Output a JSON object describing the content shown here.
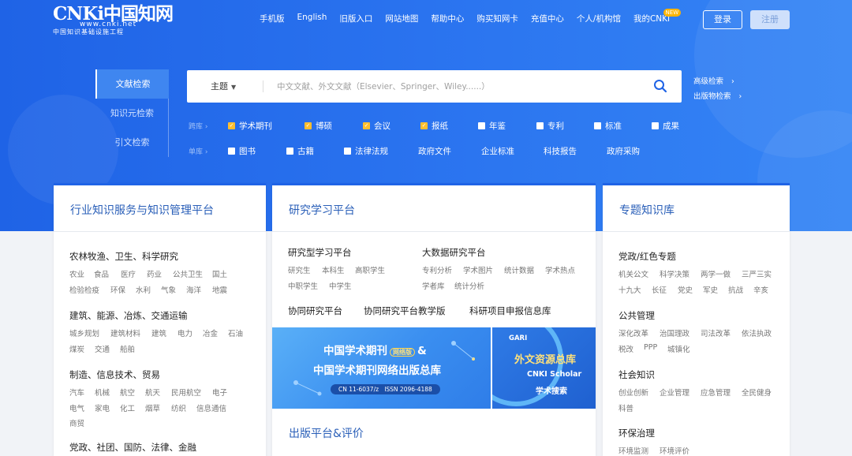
{
  "header": {
    "logo_main": "CNKi中国知网",
    "logo_url": "www.cnki.net",
    "logo_sub": "中国知识基础设施工程",
    "nav": [
      "手机版",
      "English",
      "旧版入口",
      "网站地图",
      "帮助中心",
      "购买知网卡",
      "充值中心",
      "个人/机构馆",
      "我的CNKI"
    ],
    "new_badge": "NEW",
    "login": "登录",
    "register": "注册"
  },
  "search": {
    "tabs": [
      "文献检索",
      "知识元检索",
      "引文检索"
    ],
    "type": "主题",
    "placeholder": "中文文献、外文文献（Elsevier、Springer、Wiley......）",
    "advanced": "高级检索",
    "publication": "出版物检索",
    "row1_label": "跨库",
    "row2_label": "单库",
    "row1": [
      {
        "label": "学术期刊",
        "checked": true
      },
      {
        "label": "博硕",
        "checked": true
      },
      {
        "label": "会议",
        "checked": true
      },
      {
        "label": "报纸",
        "checked": true
      },
      {
        "label": "年鉴",
        "checked": false
      },
      {
        "label": "专利",
        "checked": false
      },
      {
        "label": "标准",
        "checked": false
      },
      {
        "label": "成果",
        "checked": false
      }
    ],
    "row2": [
      {
        "label": "图书",
        "checkbox": true
      },
      {
        "label": "古籍",
        "checkbox": true
      },
      {
        "label": "法律法规",
        "checkbox": true
      },
      {
        "label": "政府文件",
        "checkbox": false
      },
      {
        "label": "企业标准",
        "checkbox": false
      },
      {
        "label": "科技报告",
        "checkbox": false
      },
      {
        "label": "政府采购",
        "checkbox": false
      }
    ]
  },
  "left_card": {
    "title": "行业知识服务与知识管理平台",
    "groups": [
      {
        "title": "农林牧渔、卫生、科学研究",
        "tags": [
          [
            "农业",
            "食品",
            "医疗",
            "药业",
            "公共卫生",
            "国土"
          ],
          [
            "检验检疫",
            "环保",
            "水利",
            "气象",
            "海洋",
            "地震"
          ]
        ]
      },
      {
        "title": "建筑、能源、冶炼、交通运输",
        "tags": [
          [
            "城乡规划",
            "建筑材料",
            "建筑",
            "电力",
            "冶金",
            "石油"
          ],
          [
            "煤炭",
            "交通",
            "船舶"
          ]
        ]
      },
      {
        "title": "制造、信息技术、贸易",
        "tags": [
          [
            "汽车",
            "机械",
            "航空",
            "航天",
            "民用航空",
            "电子"
          ],
          [
            "电气",
            "家电",
            "化工",
            "烟草",
            "纺织",
            "信息通信"
          ],
          [
            "商贸"
          ]
        ]
      },
      {
        "title": "党政、社团、国防、法律、金融",
        "tags": []
      }
    ]
  },
  "mid_card": {
    "title": "研究学习平台",
    "col1_title": "研究型学习平台",
    "col1_tags": [
      [
        "研究生",
        "本科生",
        "高职学生"
      ],
      [
        "中职学生",
        "中学生"
      ]
    ],
    "col2_title": "大数据研究平台",
    "col2_tags": [
      [
        "专利分析",
        "学术图片",
        "统计数据",
        "学术热点"
      ],
      [
        "学者库",
        "统计分析"
      ]
    ],
    "collab": [
      "协同研究平台",
      "协同研究平台教学版",
      "科研项目申报信息库"
    ],
    "banner1_line1": "中国学术期刊",
    "banner1_tag": "网络版",
    "banner1_amp": "&",
    "banner1_line2": "中国学术期刊网络出版总库",
    "banner1_cn": "CN 11-6037/z",
    "banner1_issn": "ISSN 2096-4188",
    "banner2_gari": "GARI",
    "banner2_title": "外文资源总库",
    "banner2_sub": "CNKI Scholar",
    "banner2_sub2": "学术搜索",
    "bottom_title": "出版平台&评价"
  },
  "right_card": {
    "title": "专题知识库",
    "groups": [
      {
        "title": "党政/红色专题",
        "tags": [
          [
            "机关公文",
            "科学决策",
            "两学一做",
            "三严三实"
          ],
          [
            "十九大",
            "长征",
            "党史",
            "军史",
            "抗战",
            "辛亥"
          ]
        ]
      },
      {
        "title": "公共管理",
        "tags": [
          [
            "深化改革",
            "治国理政",
            "司法改革",
            "依法执政"
          ],
          [
            "税改",
            "PPP",
            "城镇化"
          ]
        ]
      },
      {
        "title": "社会知识",
        "tags": [
          [
            "创业创新",
            "企业管理",
            "应急管理",
            "全民健身"
          ],
          [
            "科普"
          ]
        ]
      },
      {
        "title": "环保治理",
        "tags": [
          [
            "环境监测",
            "环境评价"
          ]
        ]
      }
    ]
  },
  "colors": {
    "brand": "#1f63e6",
    "checked": "#ffbe2e",
    "card_title": "#2a5fb8"
  }
}
